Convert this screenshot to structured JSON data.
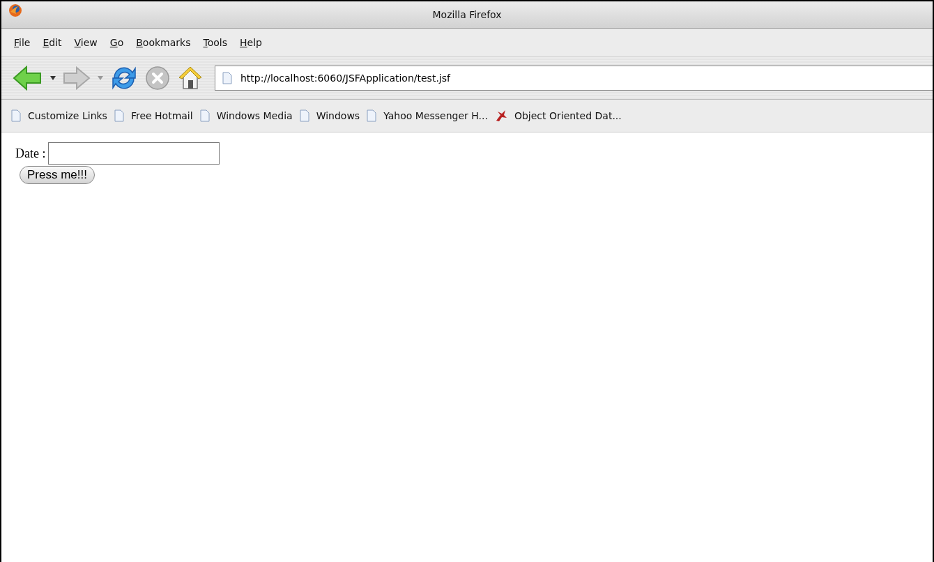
{
  "window": {
    "title": "Mozilla Firefox"
  },
  "menu": [
    "File",
    "Edit",
    "View",
    "Go",
    "Bookmarks",
    "Tools",
    "Help"
  ],
  "toolbar": {
    "back_disabled": false,
    "forward_disabled": true,
    "stop_disabled": true,
    "url": "http://localhost:6060/JSFApplication/test.jsf"
  },
  "bookmarks": [
    {
      "label": "Customize Links",
      "kind": "page"
    },
    {
      "label": "Free Hotmail",
      "kind": "page"
    },
    {
      "label": "Windows Media",
      "kind": "page"
    },
    {
      "label": "Windows",
      "kind": "page"
    },
    {
      "label": "Yahoo Messenger H...",
      "kind": "page"
    },
    {
      "label": "Object Oriented Dat...",
      "kind": "logo"
    }
  ],
  "page": {
    "date_label": "Date :",
    "button": "Press me!!!"
  }
}
